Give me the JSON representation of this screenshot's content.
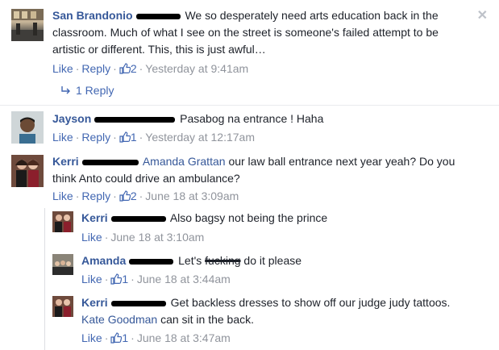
{
  "comments": [
    {
      "name": "San Brandonio",
      "text": "We so desperately need arts education back in the classroom. Much of what I see on the street is someone's failed attempt to be artistic or different. This, this is just awful…",
      "like": "Like",
      "reply": "Reply",
      "likes": "2",
      "time": "Yesterday at 9:41am"
    },
    {
      "name": "Jayson",
      "text": "Pasabog na entrance ! Haha",
      "like": "Like",
      "reply": "Reply",
      "likes": "1",
      "time": "Yesterday at 12:17am"
    },
    {
      "name": "Kerri",
      "mention": "Amanda Grattan",
      "text": "our law ball entrance next year yeah? Do you think Anto could drive an ambulance?",
      "like": "Like",
      "reply": "Reply",
      "likes": "2",
      "time": "June 18 at 3:09am"
    }
  ],
  "replies_link": "1 Reply",
  "replies": [
    {
      "name": "Kerri",
      "text": "Also bagsy not being the prince",
      "like": "Like",
      "time": "June 18 at 3:10am"
    },
    {
      "name": "Amanda",
      "text_pre": "Let's",
      "text_strike": "fucking",
      "text_post": "do it please",
      "like": "Like",
      "likes": "1",
      "time": "June 18 at 3:44am"
    },
    {
      "name": "Kerri",
      "text": "Get backless dresses to show off our judge judy tattoos.",
      "mention": "Kate Goodman",
      "text_post": "can sit in the back.",
      "like": "Like",
      "likes": "1",
      "time": "June 18 at 3:47am"
    }
  ],
  "close_glyph": "✕",
  "dot": "·",
  "icons": {
    "like": "thumbs-up-icon",
    "reply": "reply-arrow-icon",
    "close": "close-icon"
  },
  "colors": {
    "link": "#365899",
    "action": "#4267b2",
    "meta": "#90949c"
  }
}
